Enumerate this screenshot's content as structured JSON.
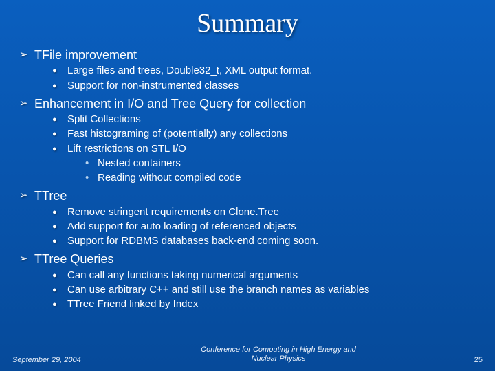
{
  "title": "Summary",
  "sections": [
    {
      "heading": "TFile improvement",
      "items": [
        {
          "text": "Large files and trees, Double32_t, XML output format."
        },
        {
          "text": "Support for non-instrumented classes"
        }
      ]
    },
    {
      "heading": "Enhancement in I/O and Tree Query for collection",
      "items": [
        {
          "text": "Split Collections"
        },
        {
          "text": "Fast histograming of (potentially) any collections"
        },
        {
          "text": "Lift restrictions on STL I/O",
          "sub": [
            "Nested containers",
            "Reading without compiled code"
          ]
        }
      ]
    },
    {
      "heading": "TTree",
      "items": [
        {
          "text": "Remove stringent requirements on Clone.Tree"
        },
        {
          "text": "Add support for auto loading of referenced objects"
        },
        {
          "text": "Support for RDBMS databases back-end coming soon."
        }
      ]
    },
    {
      "heading": "TTree Queries",
      "items": [
        {
          "text": "Can call any functions taking numerical arguments"
        },
        {
          "text": "Can use arbitrary C++ and still use the branch names as variables"
        },
        {
          "text": "TTree Friend linked by Index"
        }
      ]
    }
  ],
  "footer": {
    "date": "September 29, 2004",
    "conference_l1": "Conference for Computing in High Energy and",
    "conference_l2": "Nuclear Physics",
    "page": "25"
  }
}
